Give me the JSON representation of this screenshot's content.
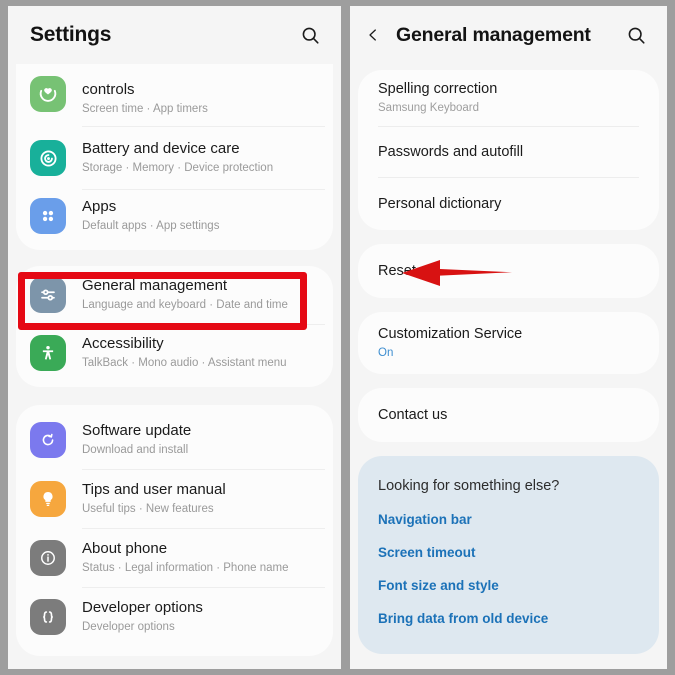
{
  "left_screen": {
    "header": {
      "title": "Settings",
      "search_icon": "search-icon"
    },
    "groups": [
      {
        "items": [
          {
            "title": "controls",
            "subtitle": "Screen time  ·  App timers",
            "icon": "digital-wellbeing-icon",
            "icon_color": "#77c274"
          },
          {
            "title": "Battery and device care",
            "subtitle": "Storage  ·  Memory  ·  Device protection",
            "icon": "battery-device-care-icon",
            "icon_color": "#18b09a"
          },
          {
            "title": "Apps",
            "subtitle": "Default apps  ·  App settings",
            "icon": "apps-grid-icon",
            "icon_color": "#6a9eea"
          }
        ]
      },
      {
        "items": [
          {
            "title": "General management",
            "subtitle": "Language and keyboard  ·  Date and time",
            "icon": "sliders-icon",
            "icon_color": "#7d95aa"
          },
          {
            "title": "Accessibility",
            "subtitle": "TalkBack  ·  Mono audio  ·  Assistant menu",
            "icon": "accessibility-person-icon",
            "icon_color": "#3aaa57"
          }
        ]
      },
      {
        "items": [
          {
            "title": "Software update",
            "subtitle": "Download and install",
            "icon": "software-update-icon",
            "icon_color": "#7b79ee"
          },
          {
            "title": "Tips and user manual",
            "subtitle": "Useful tips  ·  New features",
            "icon": "lightbulb-icon",
            "icon_color": "#f6a73e"
          },
          {
            "title": "About phone",
            "subtitle": "Status  ·  Legal information  ·  Phone name",
            "icon": "info-circle-icon",
            "icon_color": "#7c7c7c"
          },
          {
            "title": "Developer options",
            "subtitle": "Developer options",
            "icon": "developer-braces-icon",
            "icon_color": "#7c7c7c"
          }
        ]
      }
    ]
  },
  "right_screen": {
    "header": {
      "back_icon": "back-chevron-icon",
      "title": "General management",
      "search_icon": "search-icon"
    },
    "groups": [
      {
        "items": [
          {
            "title": "Spelling correction",
            "subtitle": "Samsung Keyboard",
            "subtitle_style": "muted"
          },
          {
            "title": "Passwords and autofill",
            "subtitle": "",
            "subtitle_style": "none"
          },
          {
            "title": "Personal dictionary",
            "subtitle": "",
            "subtitle_style": "none"
          }
        ]
      },
      {
        "items": [
          {
            "title": "Reset",
            "subtitle": "",
            "subtitle_style": "none"
          }
        ]
      },
      {
        "items": [
          {
            "title": "Customization Service",
            "subtitle": "On",
            "subtitle_style": "on"
          }
        ]
      },
      {
        "items": [
          {
            "title": "Contact us",
            "subtitle": "",
            "subtitle_style": "none"
          }
        ]
      }
    ],
    "suggestions": {
      "heading": "Looking for something else?",
      "links": [
        "Navigation bar",
        "Screen timeout",
        "Font size and style",
        "Bring data from old device"
      ]
    }
  },
  "annotations": {
    "highlight_box": {
      "target": "General management",
      "color": "#e50914"
    },
    "arrow": {
      "target": "Reset",
      "color": "#d81212",
      "direction": "left"
    }
  }
}
